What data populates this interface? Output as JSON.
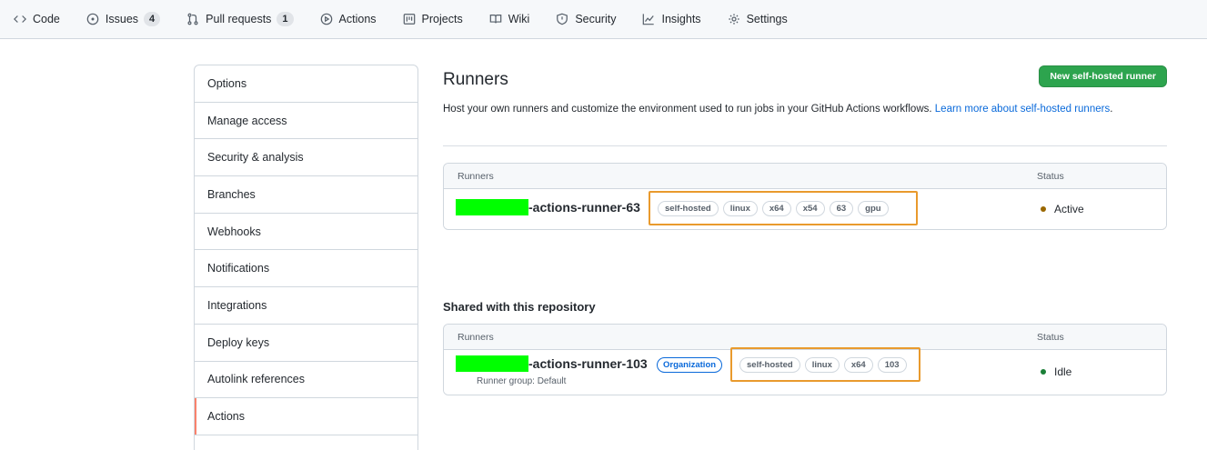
{
  "nav": {
    "code": "Code",
    "issues": "Issues",
    "issues_count": "4",
    "pulls": "Pull requests",
    "pulls_count": "1",
    "actions": "Actions",
    "projects": "Projects",
    "wiki": "Wiki",
    "security": "Security",
    "insights": "Insights",
    "settings": "Settings"
  },
  "sidebar": {
    "items": [
      {
        "label": "Options"
      },
      {
        "label": "Manage access"
      },
      {
        "label": "Security & analysis"
      },
      {
        "label": "Branches"
      },
      {
        "label": "Webhooks"
      },
      {
        "label": "Notifications"
      },
      {
        "label": "Integrations"
      },
      {
        "label": "Deploy keys"
      },
      {
        "label": "Autolink references"
      },
      {
        "label": "Actions"
      }
    ]
  },
  "main": {
    "title": "Runners",
    "new_button": "New self-hosted runner",
    "description": "Host your own runners and customize the environment used to run jobs in your GitHub Actions workflows.",
    "learn_more": "Learn more about self-hosted runners",
    "learn_more_suffix": ".",
    "repo_table": {
      "col_runners": "Runners",
      "col_status": "Status",
      "runner": {
        "name_suffix": "-actions-runner-63",
        "labels": [
          "self-hosted",
          "linux",
          "x64",
          "x54",
          "63",
          "gpu"
        ],
        "status": "Active",
        "status_color": "#9a6700"
      }
    },
    "shared_title": "Shared with this repository",
    "shared_table": {
      "col_runners": "Runners",
      "col_status": "Status",
      "runner": {
        "name_suffix": "-actions-runner-103",
        "org_label": "Organization",
        "labels": [
          "self-hosted",
          "linux",
          "x64",
          "103"
        ],
        "runner_group": "Runner group: Default",
        "status": "Idle",
        "status_color": "#1a7f37"
      }
    }
  },
  "colors": {
    "primary_button": "#2da44e",
    "link": "#0969da",
    "highlight_box": "#e99a2d",
    "redaction": "#00ff00",
    "active_marker": "#f9826c"
  }
}
